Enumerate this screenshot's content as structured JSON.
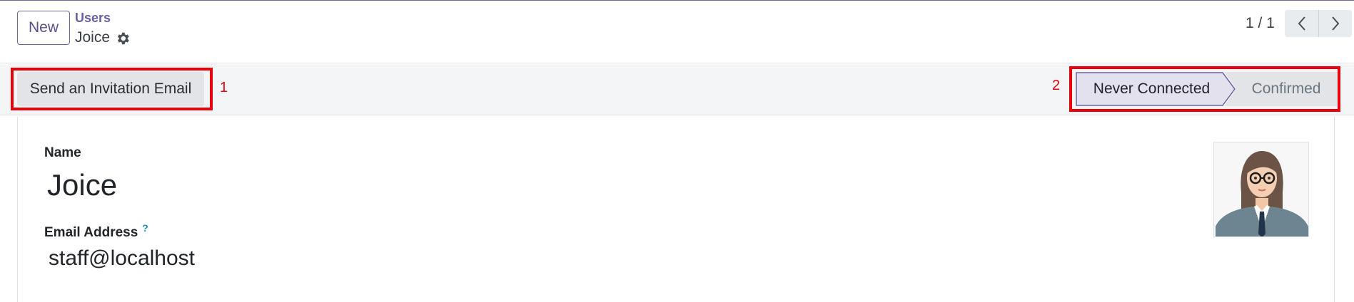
{
  "control_panel": {
    "new_button": "New",
    "breadcrumb": {
      "parent": "Users",
      "current": "Joice"
    },
    "pager": {
      "value": "1 / 1"
    }
  },
  "statusbar": {
    "invite_button": "Send an Invitation Email",
    "stages": [
      {
        "label": "Never Connected",
        "active": true
      },
      {
        "label": "Confirmed",
        "active": false
      }
    ]
  },
  "annotations": {
    "label_1": "1",
    "label_2": "2",
    "color": "#e8000b"
  },
  "form": {
    "name_label": "Name",
    "name_value": "Joice",
    "email_label": "Email Address",
    "email_help": "?",
    "email_value": "staff@localhost"
  },
  "colors": {
    "brand": "#71639e",
    "link": "#6b5fa3",
    "help": "#1f8fb5"
  },
  "icons": [
    "gear-icon",
    "chevron-left-icon",
    "chevron-right-icon",
    "avatar-image"
  ]
}
